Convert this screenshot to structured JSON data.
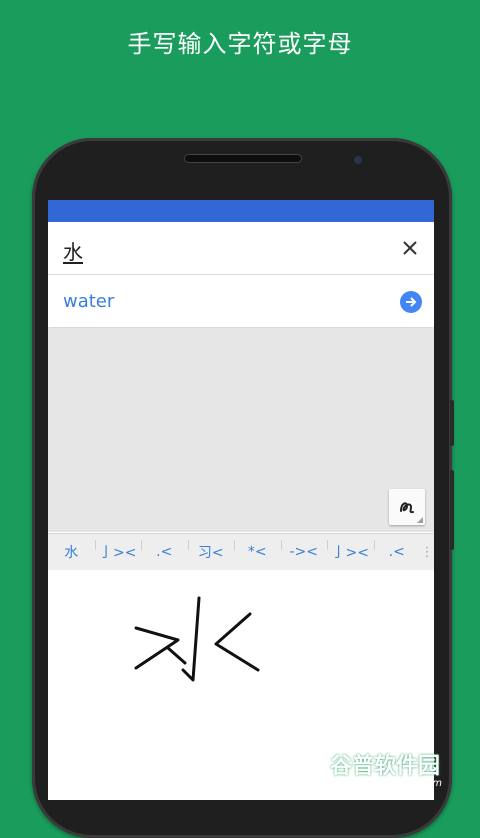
{
  "promo": {
    "title": "手写输入字符或字母"
  },
  "input": {
    "value": "水"
  },
  "translation": {
    "text": "water"
  },
  "candidates": [
    "水",
    "亅><",
    ".<",
    "习<",
    "*<",
    "-><",
    "亅><",
    ".<"
  ],
  "candidates_more_icon": "more-vertical-icon",
  "icons": {
    "clear": "close-icon",
    "go": "arrow-right-circle-icon",
    "handwriting": "handwriting-icon"
  },
  "watermark": {
    "top": "谷普软件园",
    "bottom": "www.gupuxiazai.com"
  },
  "colors": {
    "background": "#1a9d5c",
    "status_bar": "#3367d6",
    "accent": "#4285f4",
    "link": "#3b7fd6"
  }
}
